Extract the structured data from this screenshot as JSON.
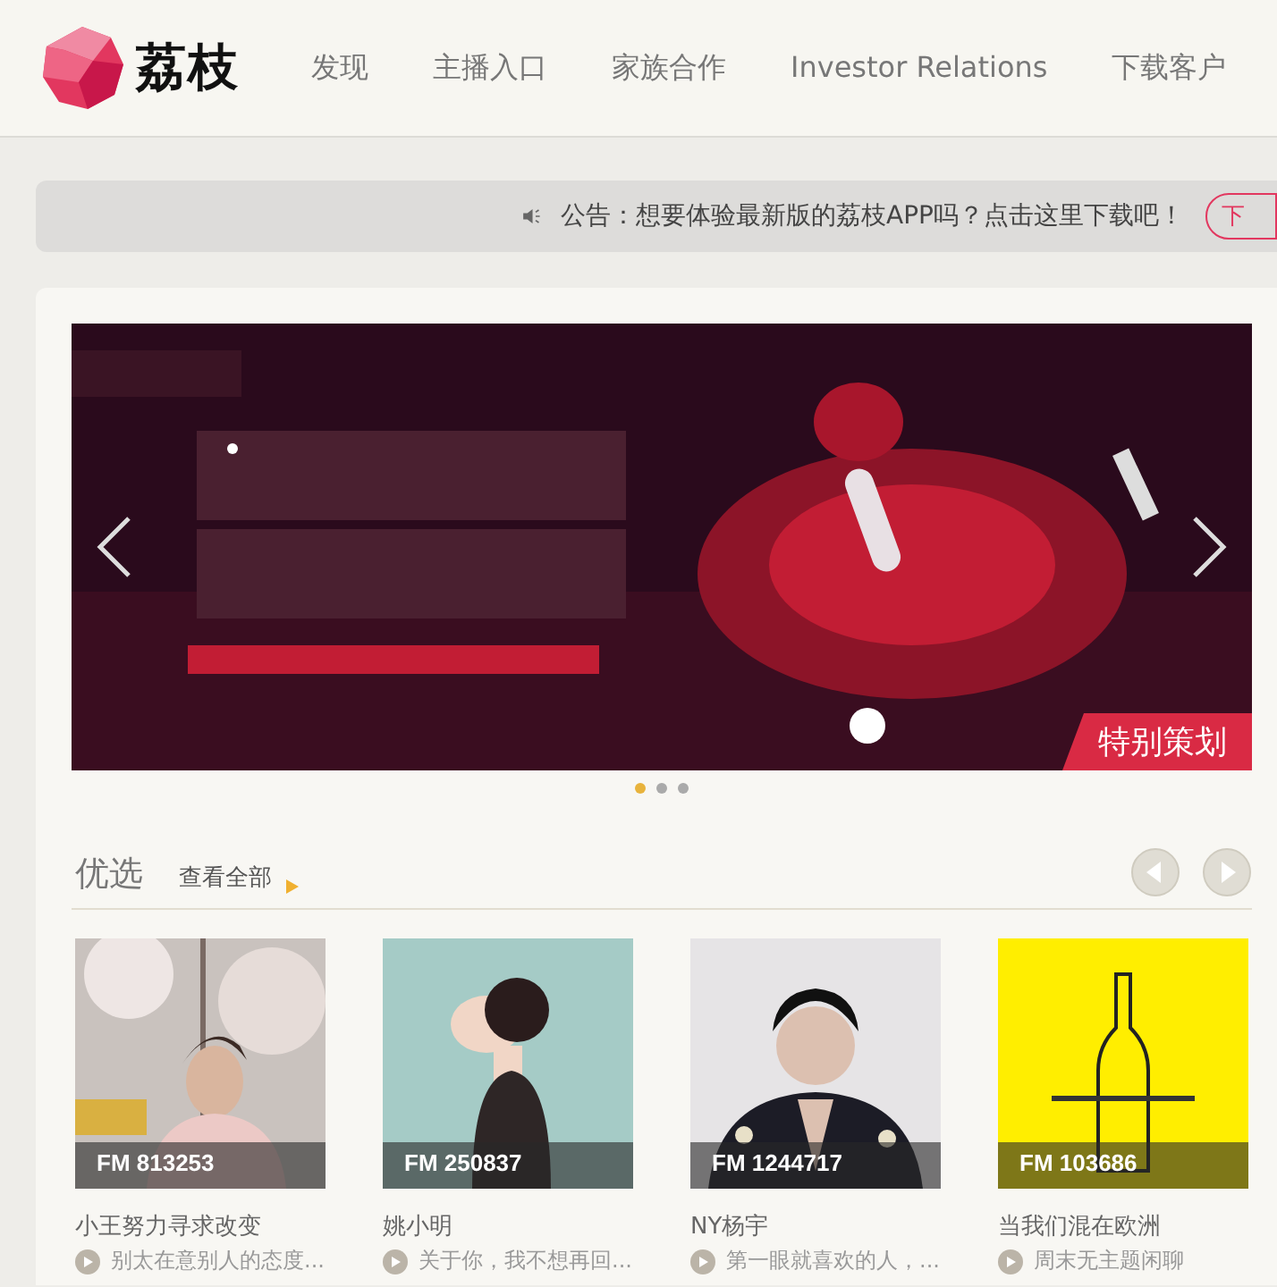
{
  "header": {
    "logo_text": "荔枝",
    "nav": [
      {
        "label": "发现"
      },
      {
        "label": "主播入口"
      },
      {
        "label": "家族合作"
      },
      {
        "label": "Investor Relations"
      },
      {
        "label": "下载客户"
      }
    ]
  },
  "notice": {
    "text": "公告：想要体验最新版的荔枝APP吗？点击这里下载吧！",
    "button": "下"
  },
  "banner": {
    "tag": "特别策划",
    "dots": [
      {
        "selected": true
      },
      {
        "selected": false
      },
      {
        "selected": false
      }
    ]
  },
  "featured": {
    "title": "优选",
    "view_all": "查看全部",
    "cards": [
      {
        "fm": "FM 813253",
        "name": "小王努力寻求改变",
        "latest": "别太在意别人的态度..."
      },
      {
        "fm": "FM 250837",
        "name": "姚小明",
        "latest": "关于你，我不想再回..."
      },
      {
        "fm": "FM 1244717",
        "name": "NY杨宇",
        "latest": "第一眼就喜欢的人，..."
      },
      {
        "fm": "FM 103686",
        "name": "当我们混在欧洲",
        "latest": "周末无主题闲聊"
      }
    ]
  }
}
